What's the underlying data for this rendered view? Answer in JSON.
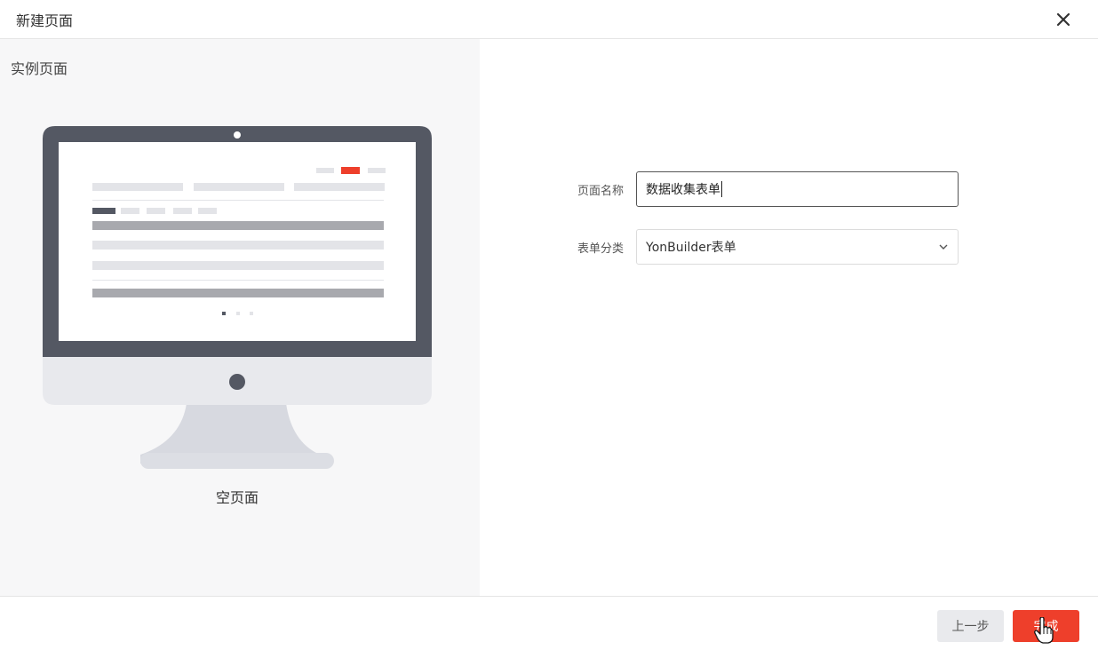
{
  "dialog": {
    "title": "新建页面",
    "close_icon": "close-icon"
  },
  "templates": {
    "section_title": "实例页面",
    "selected": {
      "caption": "空页面",
      "icon": "monitor-blank-page-icon"
    }
  },
  "form": {
    "name_label": "页面名称",
    "name_value": "数据收集表单",
    "category_label": "表单分类",
    "category_value": "YonBuilder表单",
    "category_icon": "chevron-down-icon"
  },
  "footer": {
    "prev_label": "上一步",
    "finish_label": "完成"
  },
  "colors": {
    "accent": "#ee3f2b",
    "monitor_frame": "#545863",
    "monitor_chin": "#e8e9ed"
  }
}
